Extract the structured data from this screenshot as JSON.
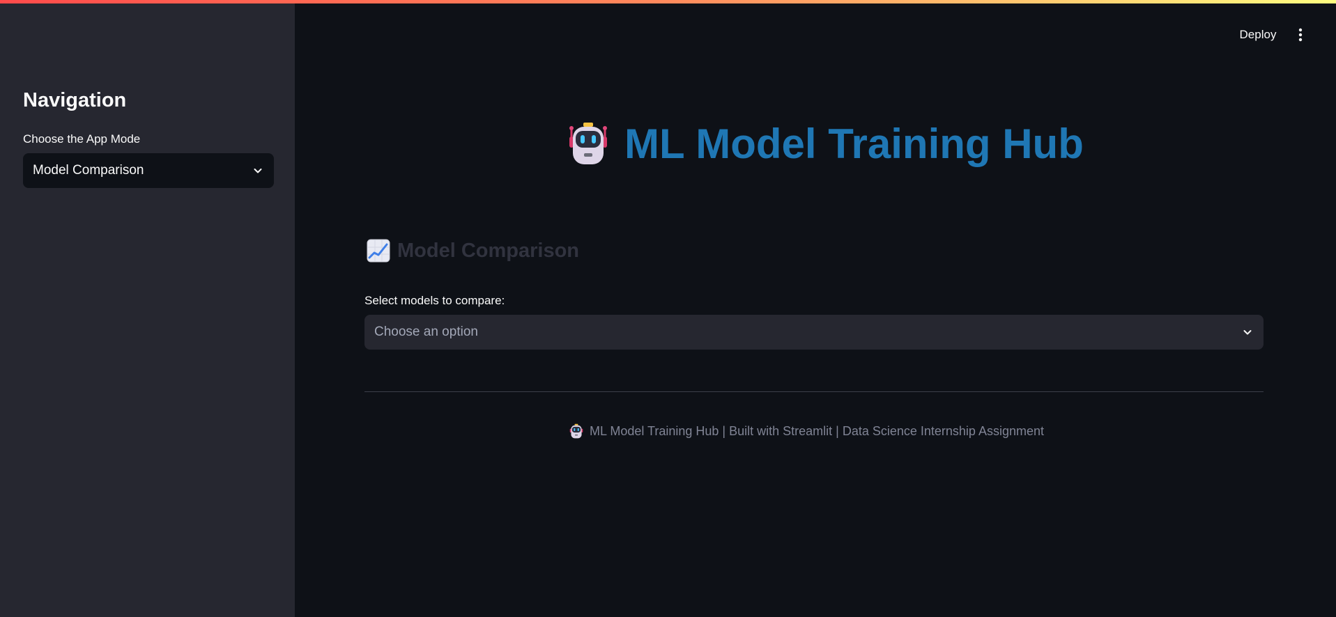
{
  "colors": {
    "app_background": "#0e1117",
    "sidebar_background": "#262730",
    "title_blue": "#1f77b4",
    "text_primary": "#fafafa",
    "text_muted": "#808495",
    "section_title": "#31333f",
    "top_bar_gradient": [
      "#ff4b4b",
      "#fffd80"
    ]
  },
  "sidebar": {
    "title": "Navigation",
    "mode_label": "Choose the App Mode",
    "mode_value": "Model Comparison",
    "mode_icon": "chevron-down-icon"
  },
  "header": {
    "deploy_label": "Deploy",
    "menu_icon": "more-vertical-icon"
  },
  "main": {
    "title_icon": "robot-icon",
    "title": "ML Model Training Hub",
    "section_icon": "chart-increasing-icon",
    "section_title": "Model Comparison",
    "compare_label": "Select models to compare:",
    "compare_placeholder": "Choose an option",
    "compare_icon": "chevron-down-icon"
  },
  "footer": {
    "icon": "robot-icon",
    "text": "ML Model Training Hub | Built with Streamlit | Data Science Internship Assignment"
  }
}
